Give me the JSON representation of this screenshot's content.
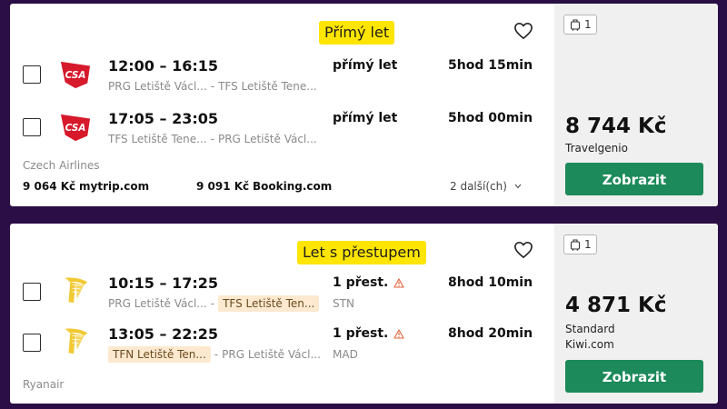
{
  "results": [
    {
      "badge": "Přímý let",
      "flights": [
        {
          "times": "12:00 – 16:15",
          "from": "PRG Letiště Václ...",
          "to": "TFS Letiště Tene...",
          "stops": "přímý let",
          "duration": "5hod 15min"
        },
        {
          "times": "17:05 – 23:05",
          "from": "TFS Letiště Tene...",
          "to": "PRG Letiště Václ...",
          "stops": "přímý let",
          "duration": "5hod 00min"
        }
      ],
      "airline": "Czech Airlines",
      "offers": [
        {
          "price": "9 064 Kč",
          "site": "mytrip.com"
        },
        {
          "price": "9 091 Kč",
          "site": "Booking.com"
        }
      ],
      "more_label": "2 další(ch)",
      "bags": "1",
      "price": "8 744 Kč",
      "provider": "Travelgenio",
      "button_label": "Zobrazit"
    },
    {
      "badge": "Let s přestupem",
      "flights": [
        {
          "times": "10:15 – 17:25",
          "from": "PRG Letiště Václ...",
          "to": "TFS Letiště Ten...",
          "stops": "1 přest.",
          "via": "STN",
          "duration": "8hod 10min"
        },
        {
          "times": "13:05 – 22:25",
          "from": "TFN Letiště Ten...",
          "to": "PRG Letiště Václ...",
          "stops": "1 přest.",
          "via": "MAD",
          "duration": "8hod 20min"
        }
      ],
      "airline": "Ryanair",
      "bags": "1",
      "price": "4 871 Kč",
      "provider_line1": "Standard",
      "provider_line2": "Kiwi.com",
      "button_label": "Zobrazit"
    }
  ],
  "colors": {
    "background": "#2a0e45",
    "badge": "#ffe500",
    "button": "#1c8a5a",
    "csa_red": "#d7192c",
    "ryanair_yellow": "#f1c933",
    "warning": "#e0603a",
    "airport_highlight": "#fde9cf"
  },
  "icons": {
    "favorite": "heart-outline-icon",
    "bag": "cabin-bag-icon",
    "warning": "warning-triangle-icon",
    "more": "chevron-down-icon"
  }
}
